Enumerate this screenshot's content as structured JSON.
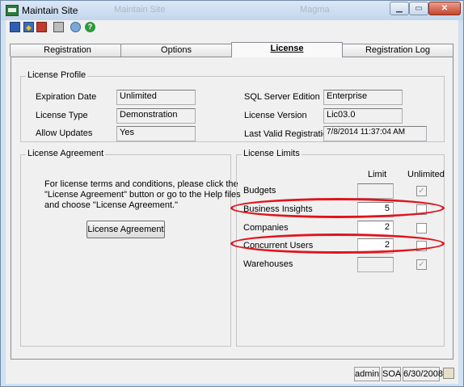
{
  "window": {
    "title": "Maintain Site",
    "ghost_titles": [
      "Maintain Site",
      "Magma"
    ],
    "controls": [
      "minimize",
      "maximize",
      "close"
    ]
  },
  "toolbar": {
    "icons": [
      "save-icon",
      "save-as-icon",
      "delete-icon",
      "print-icon",
      "sage-icon",
      "help-icon"
    ]
  },
  "tabs": [
    {
      "label": "Registration",
      "active": false
    },
    {
      "label": "Options",
      "active": false
    },
    {
      "label": "License",
      "active": true
    },
    {
      "label": "Registration Log",
      "active": false
    }
  ],
  "license_profile": {
    "title": "License Profile",
    "expiration_label": "Expiration Date",
    "expiration_value": "Unlimited",
    "type_label": "License Type",
    "type_value": "Demonstration",
    "updates_label": "Allow Updates",
    "updates_value": "Yes",
    "edition_label": "SQL Server Edition",
    "edition_value": "Enterprise",
    "version_label": "License Version",
    "version_value": "Lic03.0",
    "last_reg_label": "Last Valid Registration",
    "last_reg_value": "7/8/2014 11:37:04 AM"
  },
  "license_agreement": {
    "title": "License Agreement",
    "text_lines": [
      "For license terms and conditions, please click the",
      "\"License Agreement\" button or go to the Help files",
      "and choose \"License Agreement.\""
    ],
    "button_label": "License Agreement"
  },
  "license_limits": {
    "title": "License Limits",
    "col_limit": "Limit",
    "col_unlimited": "Unlimited",
    "rows": [
      {
        "label": "Budgets",
        "limit": "",
        "unlimited": true,
        "enabled": false
      },
      {
        "label": "Business Insights",
        "limit": "5",
        "unlimited": false,
        "enabled": true
      },
      {
        "label": "Companies",
        "limit": "2",
        "unlimited": false,
        "enabled": true
      },
      {
        "label": "Concurrent Users",
        "limit": "2",
        "unlimited": false,
        "enabled": true
      },
      {
        "label": "Warehouses",
        "limit": "",
        "unlimited": true,
        "enabled": false
      }
    ],
    "highlight_color": "#e0141c"
  },
  "statusbar": {
    "user": "admin",
    "company": "SOA",
    "date": "6/30/2008"
  }
}
